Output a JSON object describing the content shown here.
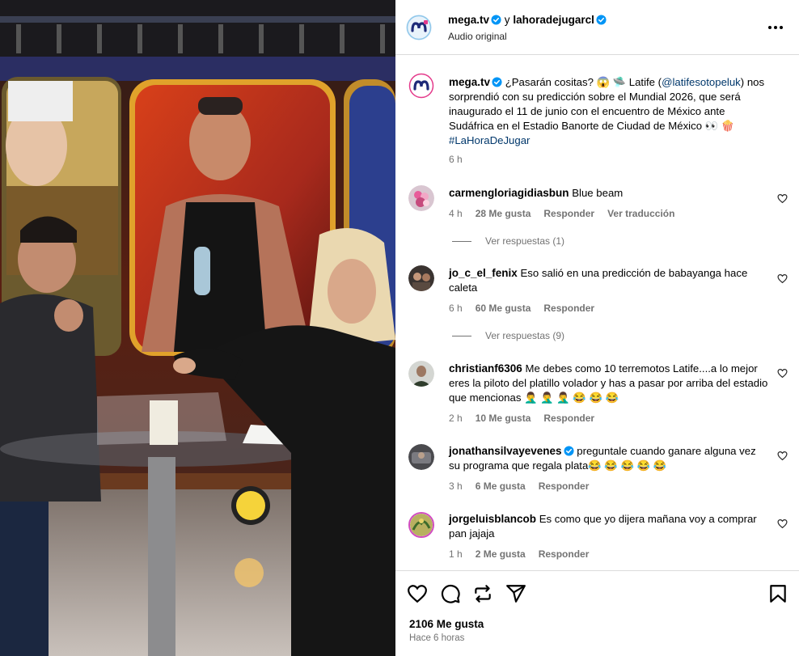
{
  "post": {
    "author": "mega.tv",
    "collab_prefix": "y",
    "collaborator": "lahoradejugarcl",
    "audio": "Audio original"
  },
  "caption": {
    "author": "mega.tv",
    "text_before_mention": "¿Pasarán cositas? 😱 🛸 Latife (",
    "mention": "@latifesotopeluk",
    "text_after_mention": ") nos sorprendió con su predicción sobre el Mundial 2026, que será inaugurado el 11 de junio con el encuentro de México ante Sudáfrica en el Estadio Banorte de Ciudad de México 👀 🍿",
    "hashtag": "#LaHoraDeJugar",
    "time": "6 h"
  },
  "comments": [
    {
      "user": "carmengloriagidiasbun",
      "text": "Blue beam",
      "time": "4 h",
      "likes": "28 Me gusta",
      "reply": "Responder",
      "translate": "Ver traducción",
      "view_replies": "Ver respuestas (1)"
    },
    {
      "user": "jo_c_el_fenix",
      "text": "Eso salió en una predicción de babayanga hace caleta",
      "time": "6 h",
      "likes": "60 Me gusta",
      "reply": "Responder",
      "view_replies": "Ver respuestas (9)"
    },
    {
      "user": "christianf6306",
      "text": "Me debes como 10 terremotos Latife....a lo mejor eres la piloto del platillo volador y has a pasar por arriba del estadio que mencionas 🤦‍♂️ 🤦‍♂️ 🤦‍♂️ 😂 😂 😂",
      "time": "2 h",
      "likes": "10 Me gusta",
      "reply": "Responder"
    },
    {
      "user": "jonathansilvayevenes",
      "text": "preguntale cuando ganare alguna vez su programa que regala plata😂 😂 😂 😂 😂",
      "time": "3 h",
      "likes": "6 Me gusta",
      "reply": "Responder"
    },
    {
      "user": "jorgeluisblancob",
      "text": "Es como que yo dijera mañana voy a comprar pan jajaja",
      "time": "1 h",
      "likes": "2 Me gusta",
      "reply": "Responder"
    }
  ],
  "footer": {
    "likes": "2106 Me gusta",
    "posted": "Hace 6 horas"
  },
  "colors": {
    "verified": "#0095f6",
    "link": "#00376b",
    "meta": "#737373",
    "border": "#dbdbdb"
  },
  "icons": [
    "verified-badge-icon",
    "more-options-icon",
    "heart-icon",
    "comment-icon",
    "repost-icon",
    "share-icon",
    "bookmark-icon"
  ]
}
